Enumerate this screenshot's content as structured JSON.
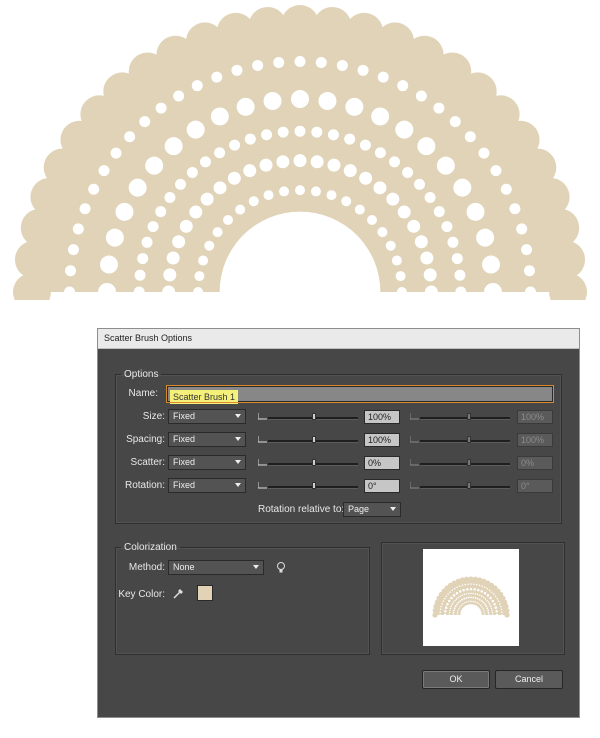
{
  "dialog": {
    "title": "Scatter Brush Options",
    "options_group_label": "Options",
    "name_label": "Name:",
    "name_value": "Scatter Brush 1",
    "rows": [
      {
        "label": "Size:",
        "mode": "Fixed",
        "value1": "100%",
        "value2": "100%"
      },
      {
        "label": "Spacing:",
        "mode": "Fixed",
        "value1": "100%",
        "value2": "100%"
      },
      {
        "label": "Scatter:",
        "mode": "Fixed",
        "value1": "0%",
        "value2": "0%"
      },
      {
        "label": "Rotation:",
        "mode": "Fixed",
        "value1": "0°",
        "value2": "0°"
      }
    ],
    "rotation_relative_label": "Rotation relative to:",
    "rotation_relative_value": "Page",
    "colorization_group_label": "Colorization",
    "method_label": "Method:",
    "method_value": "None",
    "key_color_label": "Key Color:",
    "key_color": "#e3d3b6",
    "ok_label": "OK",
    "cancel_label": "Cancel"
  },
  "artwork": {
    "fill_color": "#e0d3b7"
  }
}
